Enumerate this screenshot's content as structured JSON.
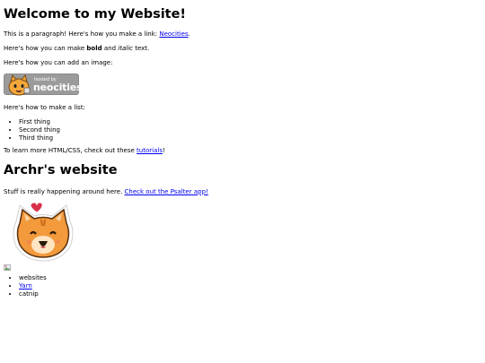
{
  "heading1": "Welcome to my Website!",
  "para_link": {
    "before": "This is a paragraph! Here's how you make a link: ",
    "link": "Neocities",
    "after": "."
  },
  "para_format": {
    "before": "Here's how you can make ",
    "bold": "bold",
    "middle": " and ",
    "italic": "italic",
    "after": " text."
  },
  "para_image": "Here's how you can add an image:",
  "badge": {
    "small_text": "hosted by",
    "big_text": "neocities",
    "colors": {
      "bg": "#9b9b9b",
      "cat": "#f5a73b"
    },
    "icon": "neocities-cat-icon"
  },
  "para_list": "Here's how to make a list:",
  "list1": [
    "First thing",
    "Second thing",
    "Third thing"
  ],
  "para_tutorial": {
    "before": "To learn more HTML/CSS, check out these ",
    "link": "tutorials",
    "after": "!"
  },
  "heading2": "Archr's website",
  "para_stuff": {
    "before": "Stuff is really happening around here. ",
    "link": "Check out the Psalter app!"
  },
  "cat_sticker": {
    "icon": "cat-heart-sticker-icon",
    "colors": {
      "face": "#f29a3c",
      "heart": "#d8314a"
    }
  },
  "list2": {
    "item1": "websites",
    "item2_link": "Yarn",
    "item3": "catnip"
  }
}
